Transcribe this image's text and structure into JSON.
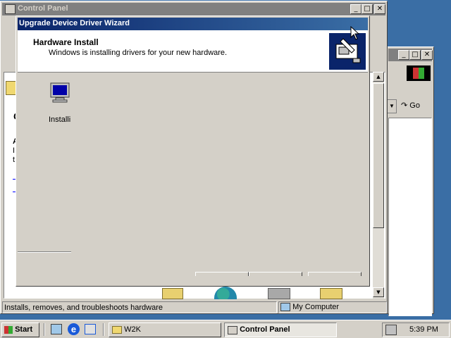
{
  "back_window": {
    "go_label": "Go",
    "win_buttons": [
      "_",
      "□",
      "✕"
    ]
  },
  "control_panel": {
    "title": "Control Panel",
    "win_buttons": [
      "_",
      "□",
      "✕"
    ],
    "status_text": "Installs, removes, and troubleshoots hardware",
    "status_location": "My Computer",
    "bg_heading": "C",
    "bg_letter_a": "A",
    "bg_letter_i": "I",
    "bg_letter_t": "t"
  },
  "wizard": {
    "title": "Upgrade Device Driver Wizard",
    "heading": "Hardware Install",
    "subheading": "Windows is installing drivers for your new hardware.",
    "install_label": "Installi"
  },
  "taskbar": {
    "start_label": "Start",
    "tasks": [
      {
        "label": "W2K",
        "active": false
      },
      {
        "label": "Control Panel",
        "active": true
      }
    ],
    "clock": "5:39 PM"
  },
  "colors": {
    "desktop": "#3a6ea5",
    "title_active": "#0a246a",
    "title_inactive": "#808080",
    "face": "#d4d0c8"
  }
}
